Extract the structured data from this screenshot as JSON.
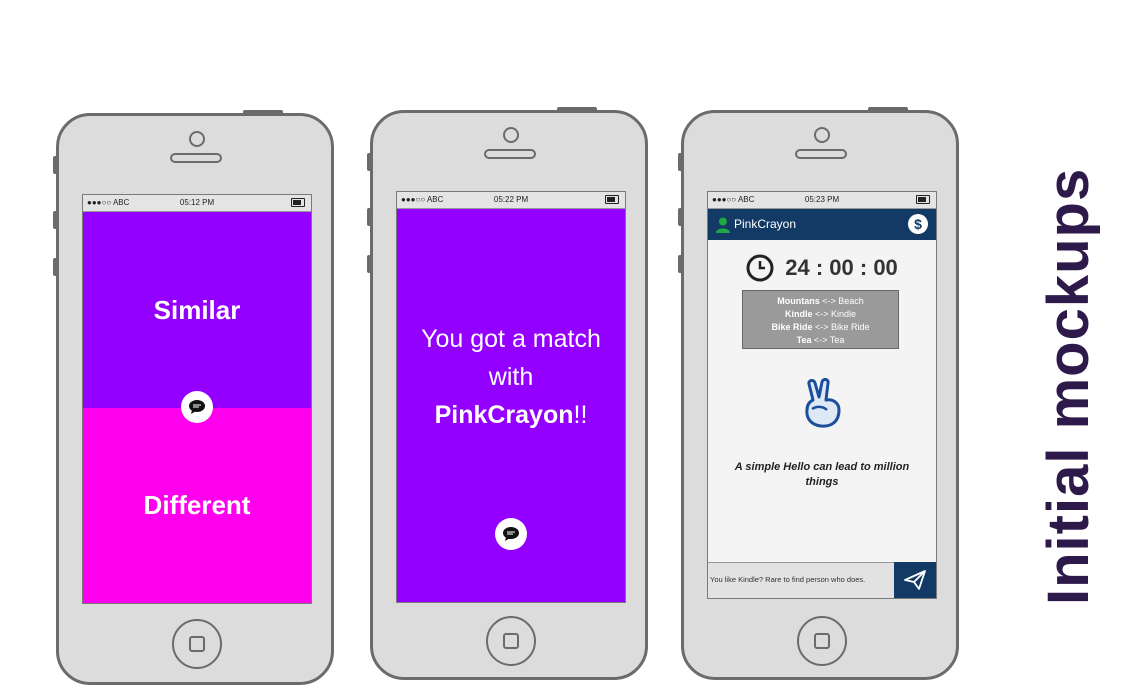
{
  "page_title": "Initial mockups",
  "status_bar": {
    "signal": "●●●○○ ABC"
  },
  "phone1": {
    "time": "05:12 PM",
    "top_label": "Similar",
    "bottom_label": "Different",
    "colors": {
      "top": "#9400ff",
      "bottom": "#ff00ee"
    }
  },
  "phone2": {
    "time": "05:22 PM",
    "line1": "You got a match",
    "line2": "with",
    "name": "PinkCrayon",
    "suffix": "!!",
    "colors": {
      "background": "#9400ff"
    }
  },
  "phone3": {
    "time": "05:23 PM",
    "header_name": "PinkCrayon",
    "timer": "24 : 00 : 00",
    "matches": [
      {
        "left": "Mountans",
        "arrow": "<->",
        "right": "Beach"
      },
      {
        "left": "Kindle",
        "arrow": "<->",
        "right": "Kindle"
      },
      {
        "left": "Bike Ride",
        "arrow": "<->",
        "right": "Bike Ride"
      },
      {
        "left": "Tea",
        "arrow": "<->",
        "right": "Tea"
      }
    ],
    "tagline": "A simple Hello can lead to million things",
    "input_value": "You like Kindle? Rare to find person who does.",
    "colors": {
      "header": "#123a64",
      "send": "#123a64"
    }
  }
}
